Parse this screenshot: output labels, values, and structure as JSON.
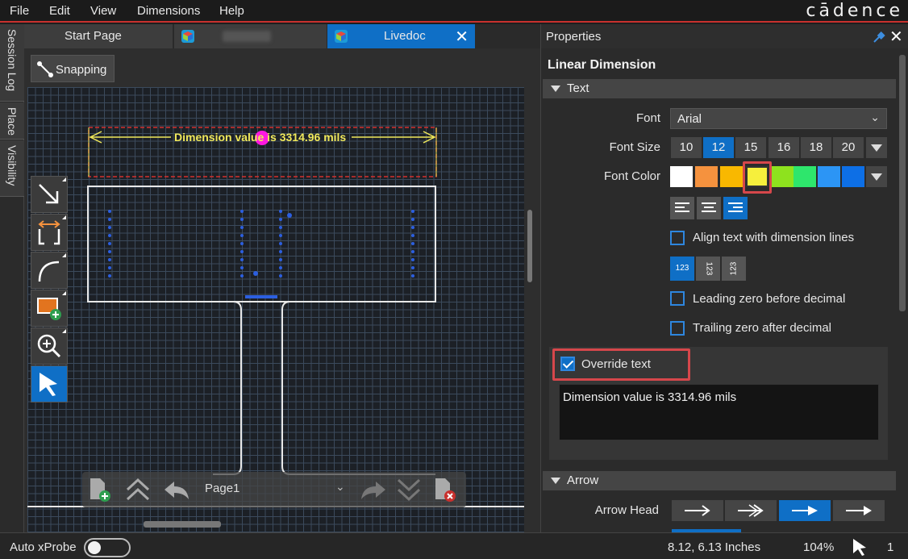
{
  "menu": [
    "File",
    "Edit",
    "View",
    "Dimensions",
    "Help"
  ],
  "brand": "cādence",
  "side_tabs": [
    "Session Log",
    "Place",
    "Visibility"
  ],
  "doc_tabs": [
    {
      "label": "Start Page"
    },
    {
      "label": ""
    },
    {
      "label": "Livedoc"
    }
  ],
  "canvas": {
    "snapping_label": "Snapping",
    "dimension_text": "Dimension value is 3314.96 mils",
    "page_label": "Page1"
  },
  "properties": {
    "header": "Properties",
    "title": "Linear Dimension",
    "text_section": "Text",
    "font_label": "Font",
    "font_value": "Arial",
    "font_size_label": "Font Size",
    "font_sizes": [
      "10",
      "12",
      "15",
      "16",
      "18",
      "20"
    ],
    "font_size_selected": "12",
    "font_color_label": "Font Color",
    "font_colors": [
      "#ffffff",
      "#f5923e",
      "#f9b800",
      "#f6ef3c",
      "#8ee21e",
      "#2ee66c",
      "#2c95f5",
      "#0d6fe6"
    ],
    "align_text_label": "Align text with dimension lines",
    "number_modes": [
      "123",
      "123",
      "123"
    ],
    "leading_zero_label": "Leading zero before decimal",
    "trailing_zero_label": "Trailing zero after decimal",
    "override_label": "Override text",
    "override_value": "Dimension value is 3314.96 mils",
    "arrow_section": "Arrow",
    "arrow_head_label": "Arrow Head"
  },
  "status": {
    "auto_xprobe_label": "Auto xProbe",
    "coords": "8.12, 6.13 Inches",
    "zoom": "104%",
    "count": "1"
  },
  "colors": {
    "accent": "#0f6fc6",
    "highlight": "#d6474b",
    "dimension_text": "#f0e85a"
  }
}
